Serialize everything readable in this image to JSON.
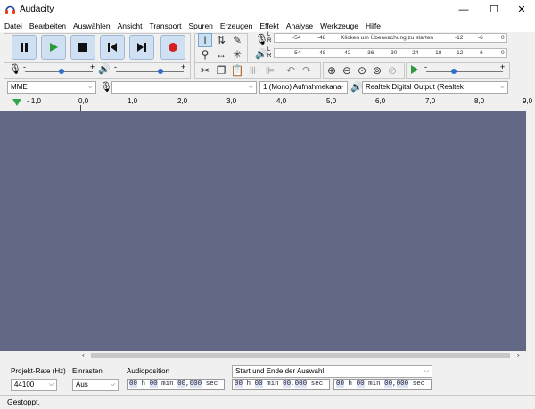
{
  "window": {
    "title": "Audacity",
    "controls": [
      "—",
      "☐",
      "✕"
    ]
  },
  "menu": [
    "Datei",
    "Bearbeiten",
    "Auswählen",
    "Ansicht",
    "Transport",
    "Spuren",
    "Erzeugen",
    "Effekt",
    "Analyse",
    "Werkzeuge",
    "Hilfe"
  ],
  "meters": {
    "record_scale": [
      "-54",
      "-48",
      "Klicken um Überwachung zu starten",
      "-12",
      "-6",
      "0"
    ],
    "playback_scale": [
      "-54",
      "-48",
      "-42",
      "-36",
      "-30",
      "-24",
      "-18",
      "-12",
      "-6",
      "0"
    ],
    "channel_l": "L",
    "channel_r": "R"
  },
  "mixer": {
    "minus": "-",
    "plus": "+"
  },
  "device": {
    "host": "MME",
    "recording_device": "",
    "channels": "1 (Mono) Aufnahmekana",
    "playback_device": "Realtek Digital Output (Realtek"
  },
  "ruler": {
    "labels": [
      "- 1,0",
      "0,0",
      "1,0",
      "2,0",
      "3,0",
      "4,0",
      "5,0",
      "6,0",
      "7,0",
      "8,0",
      "9,0"
    ]
  },
  "selection": {
    "rate_label": "Projekt-Rate (Hz)",
    "rate_value": "44100",
    "snap_label": "Einrasten",
    "snap_value": "Aus",
    "audio_pos_label": "Audioposition",
    "range_label": "Start und Ende der Auswahl",
    "audio_pos": {
      "h": "00",
      "m": "00",
      "s": "00",
      "f": "000"
    },
    "start": {
      "h": "00",
      "m": "00",
      "s": "00",
      "f": "000"
    },
    "end": {
      "h": "00",
      "m": "00",
      "s": "00",
      "f": "000"
    },
    "unit_h": "h",
    "unit_min": "min",
    "unit_sec": "sec"
  },
  "status": "Gestoppt."
}
